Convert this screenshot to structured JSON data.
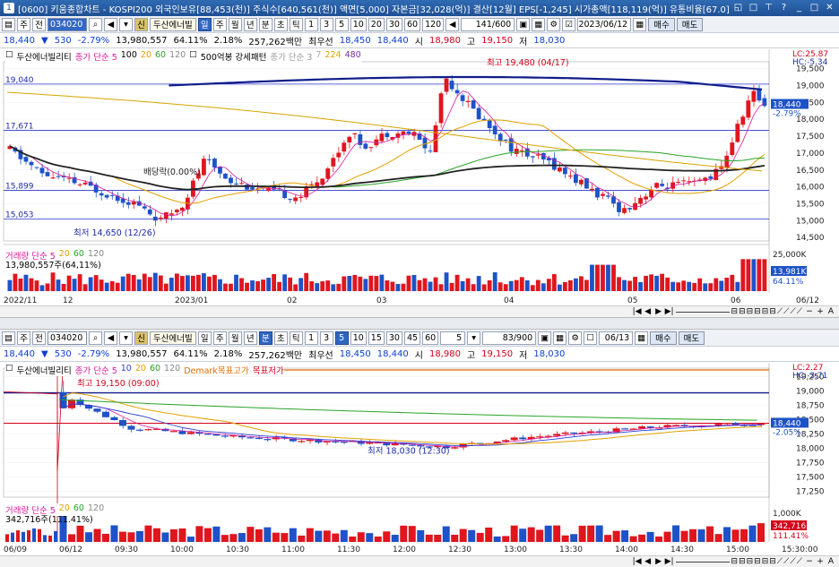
{
  "window": {
    "title": "[0600] 키움종합차트 - KOSPI200 외국인보유[88,453(천)] 주식수[640,561(천)] 액면[5,000] 자본금[32,028(억)] 결산[12월] EPS[-1,245] 시가총액[118,119(억)] 유통비율[67.0]",
    "icon_num": "1"
  },
  "top": {
    "toolbar": {
      "menu": "주",
      "jeon": "전",
      "code": "034020",
      "name": "두산에너빌",
      "periods": [
        "일",
        "주",
        "월",
        "년",
        "분",
        "초",
        "틱"
      ],
      "minutes": [
        "1",
        "3",
        "5",
        "10",
        "20",
        "30",
        "60",
        "120"
      ],
      "count": "141",
      "count_total": "/600",
      "date": "2023/06/12",
      "buy": "매수",
      "sell": "매도",
      "active_period": "일"
    },
    "quote": {
      "price": "18,440",
      "change": "530",
      "rate": "-2.79%",
      "volume": "13,980,557",
      "vol_rate": "64.11%",
      "turnover": "2.18%",
      "amount": "257,262백만",
      "pref": "최우선",
      "ask": "18,450",
      "bid": "18,440",
      "open_l": "시",
      "open": "18,980",
      "high_l": "고",
      "high": "19,150",
      "low_l": "저",
      "low": "18,030"
    },
    "legend": {
      "name": "두산에너빌리티",
      "ma": "종가 단순 5",
      "ma_vals": [
        "100",
        "20",
        "60",
        "120"
      ],
      "pattern": "500억봉 강세패턴",
      "ma2": "종가 단순 3",
      "ma2_vals": [
        "7",
        "224",
        "480"
      ]
    },
    "yticks": [
      "19,500",
      "19,000",
      "18,500",
      "18,000",
      "17,500",
      "17,000",
      "16,500",
      "16,000",
      "15,500",
      "15,000",
      "14,500"
    ],
    "lc": "LC:25.87",
    "hc": "HC:-5.34",
    "cur_price": "18,440",
    "cur_rate": "-2.79%",
    "left_levels": [
      "19,040",
      "17,671",
      "15,899",
      "15,053"
    ],
    "high_note": "최고 19,480 (04/17)",
    "low_note": "최저 14,650 (12/26)",
    "div_note": "배당락(0.00%)",
    "vol_legend": "거래량 단순 5",
    "vol_vals": [
      "20",
      "60",
      "120"
    ],
    "vol_value": "13,980,557주(64,11%)",
    "vol_ticks": [
      "25,000K",
      "13,981K",
      "64.11%"
    ],
    "xlabels": [
      "2022/11",
      "12",
      "2023/01",
      "02",
      "03",
      "04",
      "05",
      "06",
      "06/12"
    ]
  },
  "bottom": {
    "toolbar": {
      "menu": "주",
      "jeon": "전",
      "code": "034020",
      "name": "두산에너빌",
      "periods": [
        "일",
        "주",
        "월",
        "년",
        "분",
        "초",
        "틱"
      ],
      "minutes": [
        "1",
        "3",
        "5",
        "10",
        "15",
        "30",
        "45",
        "60"
      ],
      "sel_min": "5",
      "count": "83",
      "count_total": "/900",
      "date": "06/13",
      "buy": "매수",
      "sell": "매도",
      "active_period": "분"
    },
    "quote": {
      "price": "18,440",
      "change": "530",
      "rate": "-2.79%",
      "volume": "13,980,557",
      "vol_rate": "64.11%",
      "turnover": "2.18%",
      "amount": "257,262백만",
      "pref": "최우선",
      "ask": "18,450",
      "bid": "18,440",
      "open_l": "시",
      "open": "18,980",
      "high_l": "고",
      "high": "19,150",
      "low_l": "저",
      "low": "18,030"
    },
    "legend": {
      "name": "두산에너빌리티",
      "ma": "종가 단순 5",
      "ma_vals": [
        "10",
        "20",
        "60",
        "120"
      ],
      "demark": "Demark목표고가",
      "demark2": "목표저가"
    },
    "yticks": [
      "19,250",
      "19,000",
      "18,750",
      "18,500",
      "18,250",
      "18,000",
      "17,750",
      "17,500",
      "17,250"
    ],
    "lc": "LC:2.27",
    "hc": "HC:-3.71",
    "cur_price": "18,440",
    "cur_rate": "-2.05%",
    "high_note": "최고 19,150 (09:00)",
    "low_note": "최저 18,030 (12:30)",
    "vol_legend": "거래량 단순 5",
    "vol_vals": [
      "20",
      "60",
      "120"
    ],
    "vol_value": "342,716주(111.41%)",
    "vol_ticks": [
      "1,000K",
      "342,716",
      "111.41%"
    ],
    "xlabels": [
      "06/09",
      "06/12",
      "09:30",
      "10:00",
      "10:30",
      "11:00",
      "11:30",
      "12:00",
      "12:30",
      "13:00",
      "13:30",
      "14:00",
      "14:30",
      "15:00",
      "15:30:00"
    ]
  },
  "colors": {
    "up": "#e0161e",
    "down": "#1e52c8",
    "ma5": "#d6189a",
    "ma20": "#e4a000",
    "ma60": "#28a428",
    "ma120": "#222222",
    "long": "#0f1d8a"
  }
}
